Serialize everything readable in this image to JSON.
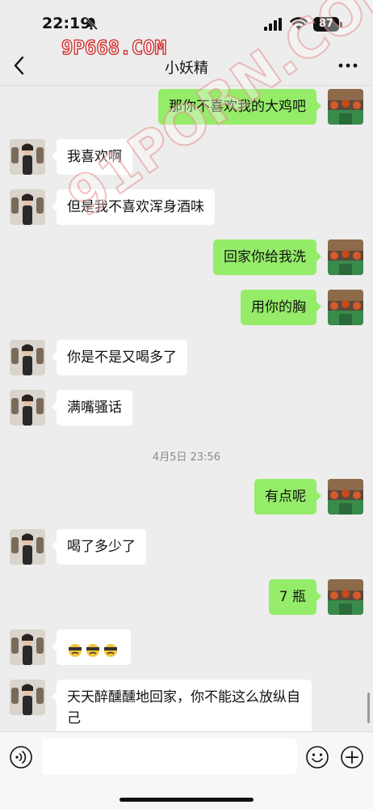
{
  "status": {
    "time": "22:19",
    "battery": "87"
  },
  "watermarks": {
    "top": "9P668.COM",
    "diagonal": "91PORN.COM"
  },
  "nav": {
    "title": "小妖精"
  },
  "messages": [
    {
      "side": "right",
      "text": "那你不喜欢我的大鸡吧"
    },
    {
      "side": "left",
      "text": "我喜欢啊"
    },
    {
      "side": "left",
      "text": "但是我不喜欢浑身酒味"
    },
    {
      "side": "right",
      "text": "回家你给我洗"
    },
    {
      "side": "right",
      "text": "用你的胸"
    },
    {
      "side": "left",
      "text": "你是不是又喝多了"
    },
    {
      "side": "left",
      "text": "满嘴骚话"
    },
    {
      "timestamp": "4月5日 23:56"
    },
    {
      "side": "right",
      "text": "有点呢"
    },
    {
      "side": "left",
      "text": "喝了多少了"
    },
    {
      "side": "right",
      "text": "7 瓶"
    },
    {
      "side": "left",
      "emoji": "drunk-face",
      "count": 3
    },
    {
      "side": "left",
      "text": "天天醉醺醺地回家，你不能这么放纵自己"
    }
  ],
  "colors": {
    "background": "#ededed",
    "sent_bubble": "#95ec69",
    "received_bubble": "#ffffff"
  },
  "icons": [
    "bell-slash-icon",
    "signal-icon",
    "wifi-icon",
    "back-chevron-icon",
    "more-icon",
    "voice-icon",
    "emoji-icon",
    "plus-icon"
  ]
}
